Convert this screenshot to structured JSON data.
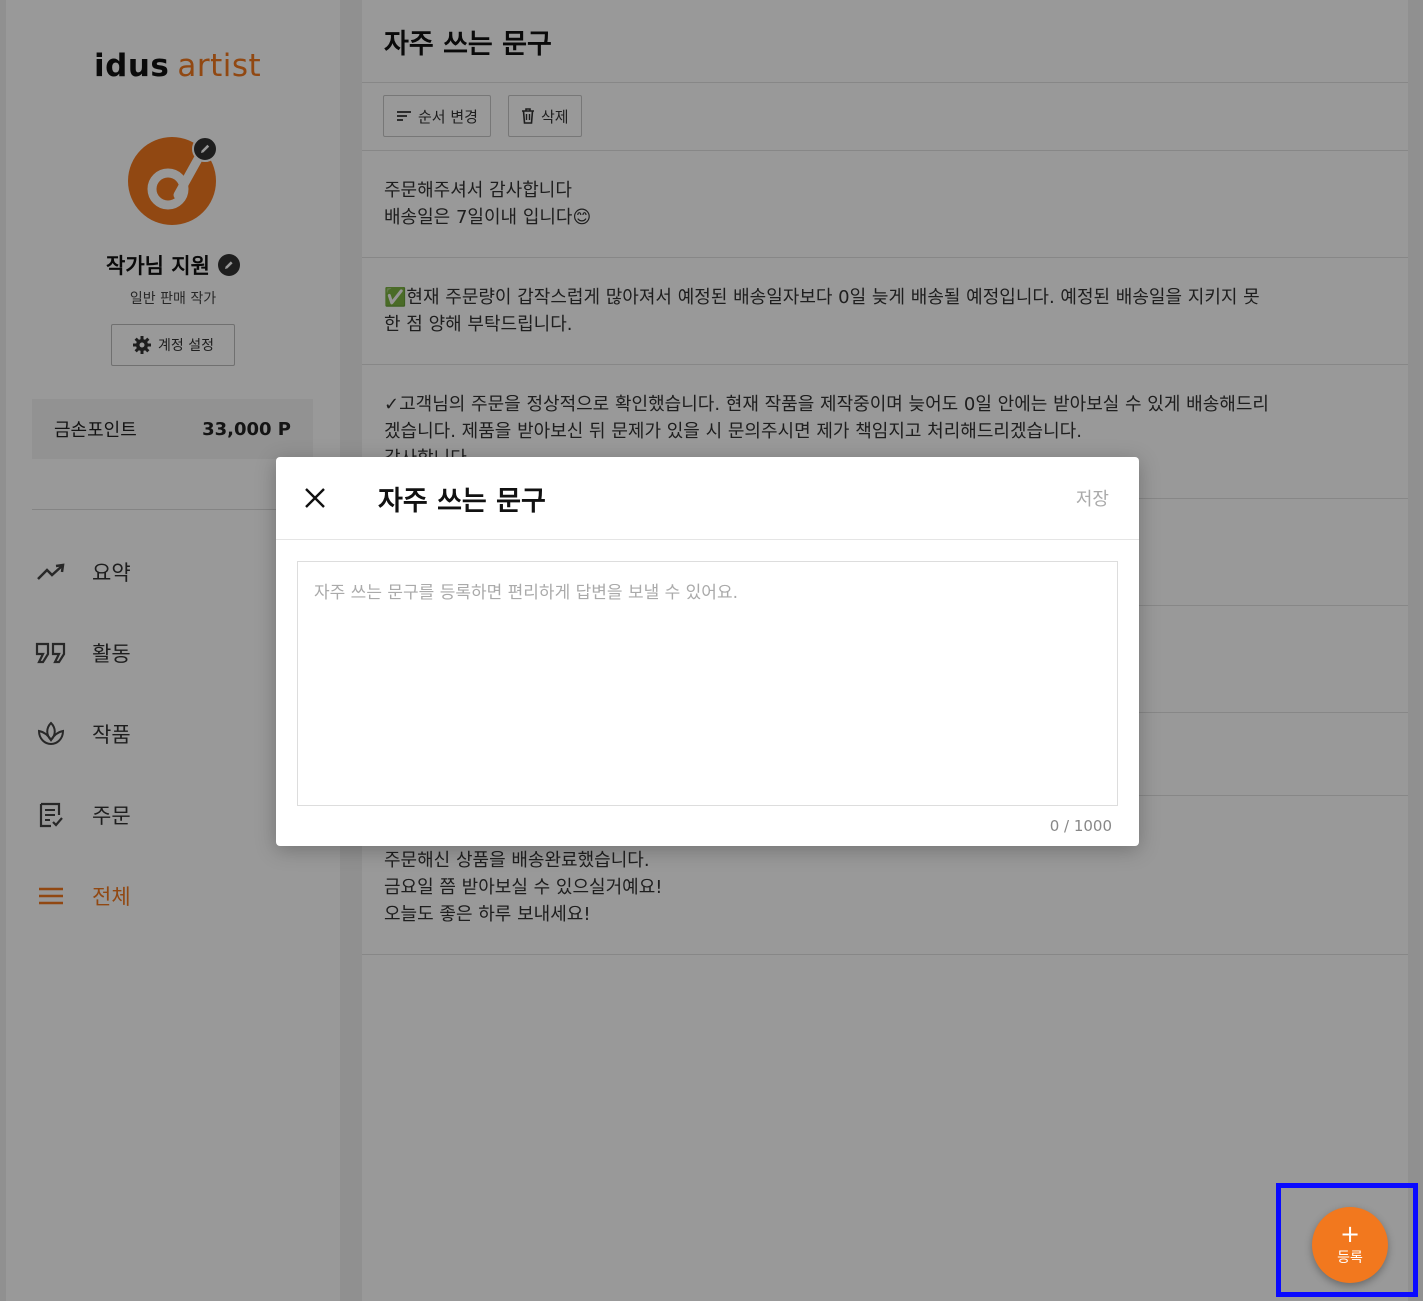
{
  "sidebar": {
    "logo_idus": "idus",
    "logo_artist": "artist",
    "artist_name": "작가님 지원",
    "artist_type": "일반 판매 작가",
    "account_settings_label": "계정 설정",
    "points_label": "금손포인트",
    "points_value": "33,000 P",
    "nav": [
      {
        "label": "요약",
        "icon": "trend-up-icon"
      },
      {
        "label": "활동",
        "icon": "quote-icon"
      },
      {
        "label": "작품",
        "icon": "lotus-icon"
      },
      {
        "label": "주문",
        "icon": "order-list-icon"
      },
      {
        "label": "전체",
        "icon": "menu-icon",
        "active": true
      }
    ]
  },
  "main": {
    "title": "자주 쓰는 문구",
    "reorder_label": "순서 변경",
    "delete_label": "삭제",
    "phrases": [
      {
        "lines": [
          "주문해주셔서 감사합니다",
          "배송일은 7일이내 입니다😊"
        ]
      },
      {
        "lines": [
          "✅현재 주문량이 갑작스럽게 많아져서 예정된 배송일자보다 0일 늦게 배송될 예정입니다. 예정된 배송일을 지키지 못",
          "한 점 양해 부탁드립니다."
        ]
      },
      {
        "lines": [
          "✓고객님의 주문을 정상적으로 확인했습니다. 현재 작품을 제작중이며 늦어도 0일 안에는 받아보실 수 있게 배송해드리",
          "겠습니다. 제품을 받아보신 뒤 문제가 있을 시 문의주시면 제가 책임지고 처리해드리겠습니다.",
          "감사합니다"
        ]
      },
      {
        "lines": [
          "주문해신 상품을 배송완료했습니다.",
          "금요일 쯤 받아보실 수 있으실거예요!",
          "오늘도 좋은 하루 보내세요!"
        ]
      }
    ]
  },
  "modal": {
    "title": "자주 쓰는 문구",
    "save_label": "저장",
    "placeholder": "자주 쓰는 문구를 등록하면 편리하게 답변을 보낼 수 있어요.",
    "value": "",
    "counter": "0 / 1000"
  },
  "fab": {
    "plus": "+",
    "label": "등록"
  },
  "colors": {
    "accent": "#f2781e",
    "highlight": "#0a0aff"
  }
}
